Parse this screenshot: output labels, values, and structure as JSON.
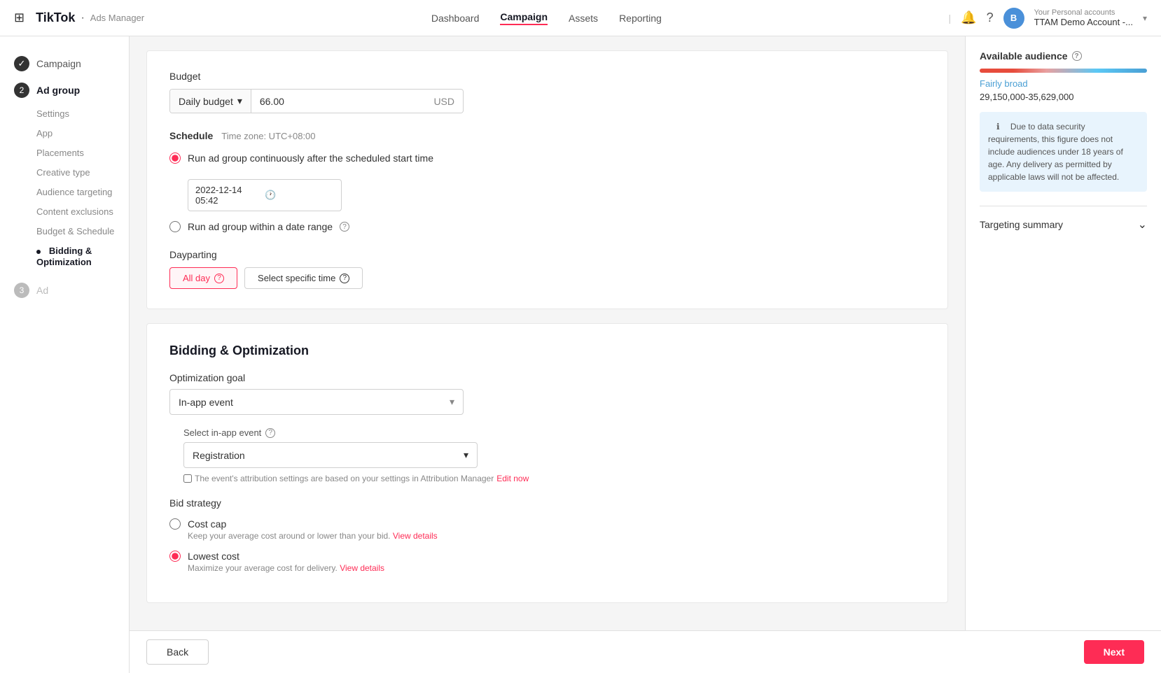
{
  "topNav": {
    "appIcon": "⊞",
    "brand": "TikTok",
    "brandSub": "Ads Manager",
    "links": [
      {
        "label": "Dashboard",
        "active": false
      },
      {
        "label": "Campaign",
        "active": true
      },
      {
        "label": "Assets",
        "active": false
      },
      {
        "label": "Reporting",
        "active": false
      }
    ],
    "divider": "|",
    "accountLabel": "Your Personal accounts",
    "accountName": "TTAM Demo Account -...",
    "avatarInitial": "B"
  },
  "sidebar": {
    "steps": [
      {
        "type": "check",
        "label": "Campaign",
        "active": false
      },
      {
        "type": "num",
        "num": "2",
        "label": "Ad group",
        "active": true,
        "subs": [
          {
            "label": "Settings",
            "active": false,
            "dot": false
          },
          {
            "label": "App",
            "active": false,
            "dot": false
          },
          {
            "label": "Placements",
            "active": false,
            "dot": false
          },
          {
            "label": "Creative type",
            "active": false,
            "dot": false
          },
          {
            "label": "Audience targeting",
            "active": false,
            "dot": false
          },
          {
            "label": "Content exclusions",
            "active": false,
            "dot": false
          },
          {
            "label": "Budget & Schedule",
            "active": false,
            "dot": false
          },
          {
            "label": "Bidding & Optimization",
            "active": true,
            "dot": true
          }
        ]
      },
      {
        "type": "num",
        "num": "3",
        "label": "Ad",
        "active": false
      }
    ]
  },
  "budget": {
    "sectionLabel": "Budget",
    "budgetType": "Daily budget",
    "budgetValue": "66.00",
    "currency": "USD"
  },
  "schedule": {
    "sectionLabel": "Schedule",
    "timezone": "Time zone: UTC+08:00",
    "option1Label": "Run ad group continuously after the scheduled start time",
    "datetimeValue": "2022-12-14 05:42",
    "option2Label": "Run ad group within a date range",
    "helpIcon": "?"
  },
  "dayparting": {
    "sectionLabel": "Dayparting",
    "options": [
      {
        "label": "All day",
        "active": true
      },
      {
        "label": "Select specific time",
        "active": false
      }
    ]
  },
  "biddingSection": {
    "sectionTitle": "Bidding & Optimization",
    "optimizationGoalLabel": "Optimization goal",
    "optimizationGoalValue": "In-app event",
    "chevron": "▾",
    "inAppEventLabel": "Select in-app event",
    "inAppEventValue": "Registration",
    "attributionNote": "The event's attribution settings are based on your settings in Attribution Manager",
    "editNowLabel": "Edit now",
    "bidStrategyLabel": "Bid strategy",
    "bidOptions": [
      {
        "id": "cost-cap",
        "label": "Cost cap",
        "desc": "Keep your average cost around or lower than your bid.",
        "viewDetailsLabel": "View details",
        "selected": false
      },
      {
        "id": "lowest-cost",
        "label": "Lowest cost",
        "desc": "Maximize your average cost for delivery.",
        "viewDetailsLabel": "View details",
        "selected": true
      }
    ]
  },
  "bottomBar": {
    "backLabel": "Back",
    "nextLabel": "Next"
  },
  "rightPanel": {
    "availableAudienceLabel": "Available audience",
    "broadnessLabel": "Fairly broad",
    "rangeLabel": "29,150,000-35,629,000",
    "noticeText": "Due to data security requirements, this figure does not include audiences under 18 years of age. Any delivery as permitted by applicable laws will not be affected.",
    "targetingSummaryLabel": "Targeting summary"
  }
}
